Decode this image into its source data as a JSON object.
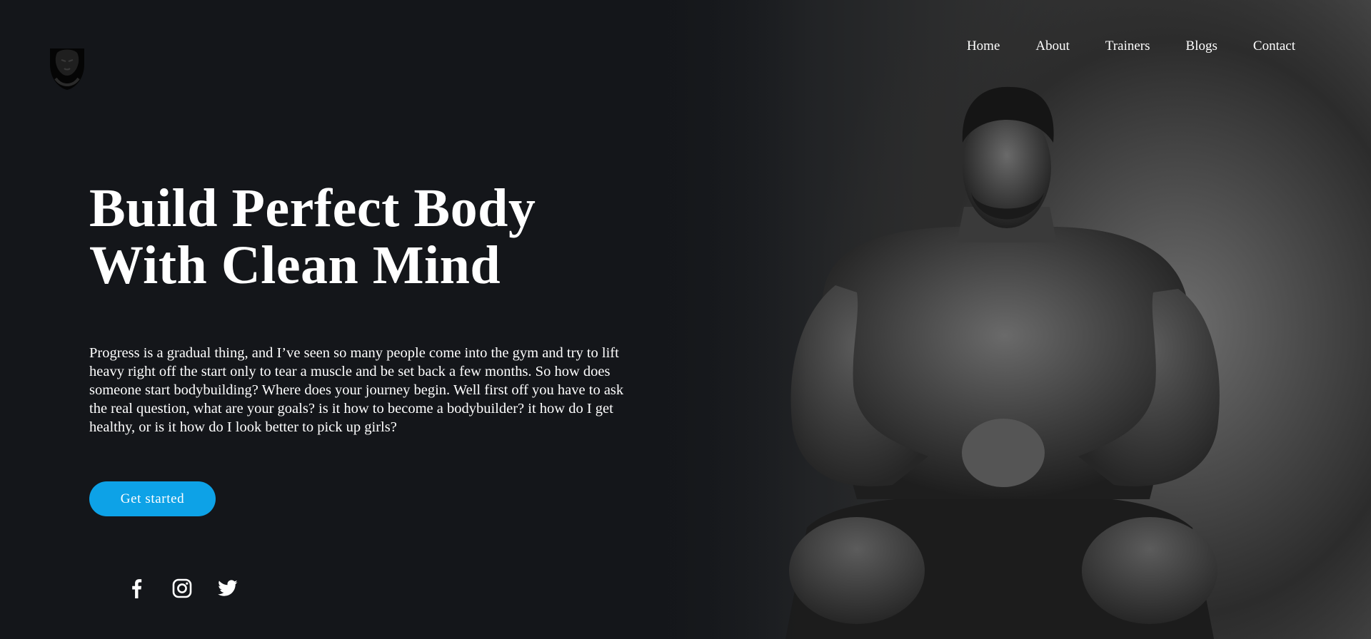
{
  "brand": {
    "logo_icon": "lion-shield-logo-icon"
  },
  "nav": {
    "items": [
      {
        "label": "Home"
      },
      {
        "label": "About"
      },
      {
        "label": "Trainers"
      },
      {
        "label": "Blogs"
      },
      {
        "label": "Contact"
      }
    ]
  },
  "hero": {
    "title_line1": "Build Perfect Body",
    "title_line2": "With Clean Mind",
    "description": "Progress is a gradual thing, and I’ve seen so many people come into the gym and try to lift heavy right off the start only to tear a muscle and be set back a few months. So how does someone start bodybuilding? Where does your journey begin. Well first off you have to ask the real question, what are your goals? is it how to become a bodybuilder? it how do I get healthy, or is it how do I look better to pick up girls?",
    "cta_label": "Get started",
    "image_icon": "bodybuilder-photo"
  },
  "social": {
    "icons": [
      "facebook-icon",
      "instagram-icon",
      "twitter-icon"
    ]
  },
  "colors": {
    "background": "#14161a",
    "accent": "#0da2e7",
    "text": "#ffffff"
  }
}
